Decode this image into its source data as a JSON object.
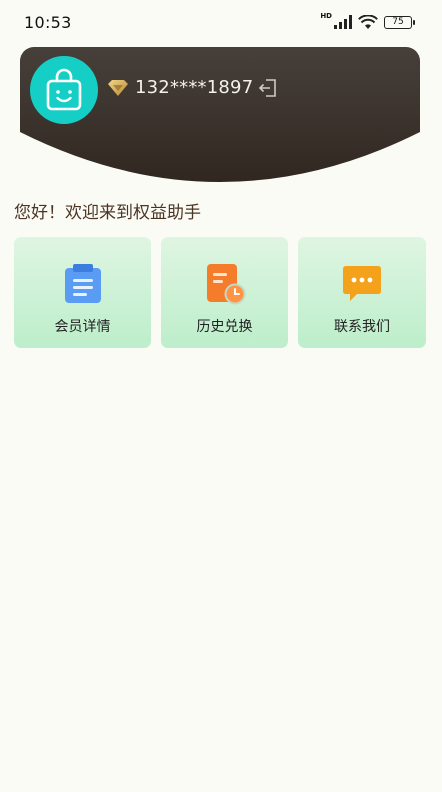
{
  "status_bar": {
    "time": "10:53",
    "network": "HD",
    "battery": "75"
  },
  "header": {
    "phone": "132****1897",
    "avatar_icon": "shopping-bag-smile-icon",
    "vip_icon": "diamond-icon",
    "logout_icon": "logout-icon"
  },
  "greeting": "您好！欢迎来到权益助手",
  "menu": [
    {
      "label": "会员详情",
      "icon": "clipboard-icon",
      "color": "#4a90f0"
    },
    {
      "label": "历史兑换",
      "icon": "document-clock-icon",
      "color": "#f57c2a"
    },
    {
      "label": "联系我们",
      "icon": "chat-bubble-icon",
      "color": "#f4a11b"
    }
  ],
  "colors": {
    "header_bg": "#3d342b",
    "avatar_bg": "#15cfc7",
    "card_bg": "#c8f0d3",
    "page_bg": "#fbfbf5"
  }
}
